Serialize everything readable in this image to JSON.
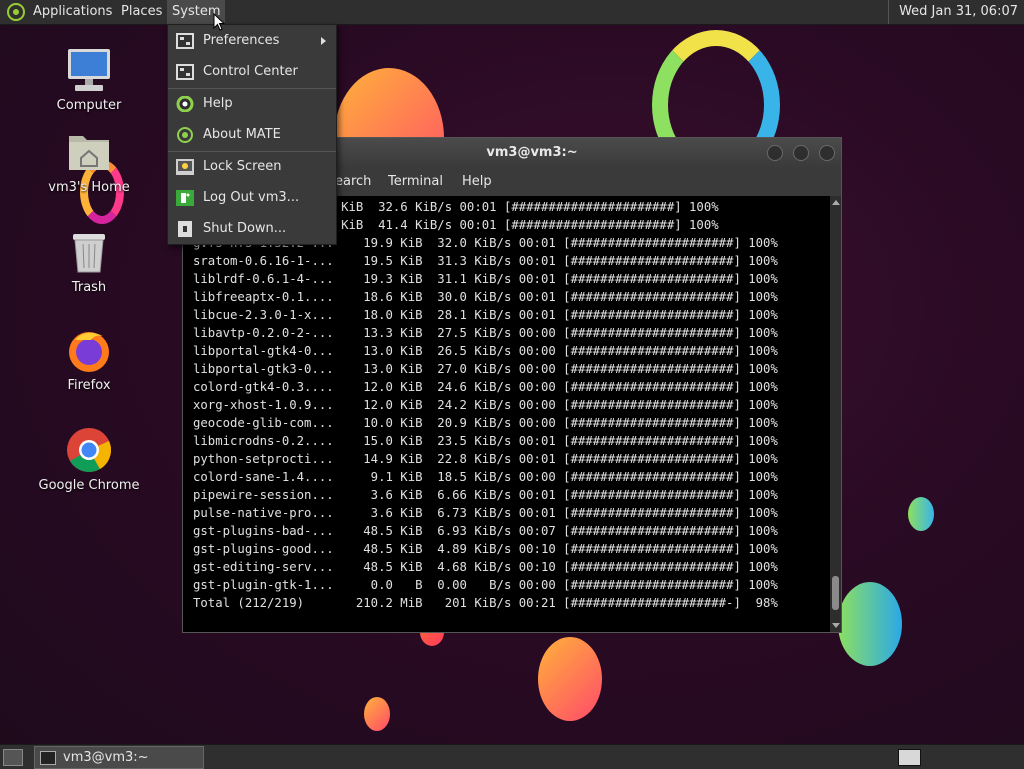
{
  "top_panel": {
    "applications": "Applications",
    "places": "Places",
    "system": "System",
    "clock": "Wed Jan 31, 06:07"
  },
  "desktop_icons": [
    {
      "label": "Computer",
      "icon": "computer-icon"
    },
    {
      "label": "vm3's Home",
      "icon": "home-folder-icon"
    },
    {
      "label": "Trash",
      "icon": "trash-icon"
    },
    {
      "label": "Firefox",
      "icon": "firefox-icon"
    },
    {
      "label": "Google Chrome",
      "icon": "chrome-icon"
    }
  ],
  "system_menu": {
    "items": [
      {
        "label": "Preferences",
        "icon": "preferences-icon",
        "submenu": true
      },
      {
        "label": "Control Center",
        "icon": "control-center-icon"
      },
      {
        "label": "Help",
        "icon": "help-icon"
      },
      {
        "label": "About MATE",
        "icon": "mate-icon"
      },
      {
        "label": "Lock Screen",
        "icon": "lock-icon"
      },
      {
        "label": "Log Out vm3...",
        "icon": "logout-icon"
      },
      {
        "label": "Shut Down...",
        "icon": "shutdown-icon"
      }
    ]
  },
  "terminal": {
    "title": "vm3@vm3:~",
    "menu": [
      "earch",
      "Terminal",
      "Help"
    ],
    "lines": [
      "...........    20.6 KiB  32.6 KiB/s 00:01 [######################] 100%",
      "..........4    27.4 KiB  41.4 KiB/s 00:01 [######################] 100%",
      "gvfs-nfs-1.52.2-...    19.9 KiB  32.0 KiB/s 00:01 [######################] 100%",
      "sratom-0.6.16-1-...    19.5 KiB  31.3 KiB/s 00:01 [######################] 100%",
      "liblrdf-0.6.1-4-...    19.3 KiB  31.1 KiB/s 00:01 [######################] 100%",
      "libfreeaptx-0.1....    18.6 KiB  30.0 KiB/s 00:01 [######################] 100%",
      "libcue-2.3.0-1-x...    18.0 KiB  28.1 KiB/s 00:01 [######################] 100%",
      "libavtp-0.2.0-2-...    13.3 KiB  27.5 KiB/s 00:00 [######################] 100%",
      "libportal-gtk4-0...    13.0 KiB  26.5 KiB/s 00:00 [######################] 100%",
      "libportal-gtk3-0...    13.0 KiB  27.0 KiB/s 00:00 [######################] 100%",
      "colord-gtk4-0.3....    12.0 KiB  24.6 KiB/s 00:00 [######################] 100%",
      "xorg-xhost-1.0.9...    12.0 KiB  24.2 KiB/s 00:00 [######################] 100%",
      "geocode-glib-com...    10.0 KiB  20.9 KiB/s 00:00 [######################] 100%",
      "libmicrodns-0.2....    15.0 KiB  23.5 KiB/s 00:01 [######################] 100%",
      "python-setprocti...    14.9 KiB  22.8 KiB/s 00:01 [######################] 100%",
      "colord-sane-1.4....     9.1 KiB  18.5 KiB/s 00:00 [######################] 100%",
      "pipewire-session...     3.6 KiB  6.66 KiB/s 00:01 [######################] 100%",
      "pulse-native-pro...     3.6 KiB  6.73 KiB/s 00:01 [######################] 100%",
      "gst-plugins-bad-...    48.5 KiB  6.93 KiB/s 00:07 [######################] 100%",
      "gst-plugins-good...    48.5 KiB  4.89 KiB/s 00:10 [######################] 100%",
      "gst-editing-serv...    48.5 KiB  4.68 KiB/s 00:10 [######################] 100%",
      "gst-plugin-gtk-1...     0.0   B  0.00   B/s 00:00 [######################] 100%",
      "Total (212/219)       210.2 MiB   201 KiB/s 00:21 [#####################-]  98%"
    ]
  },
  "bottom_panel": {
    "task_label": "vm3@vm3:~"
  }
}
